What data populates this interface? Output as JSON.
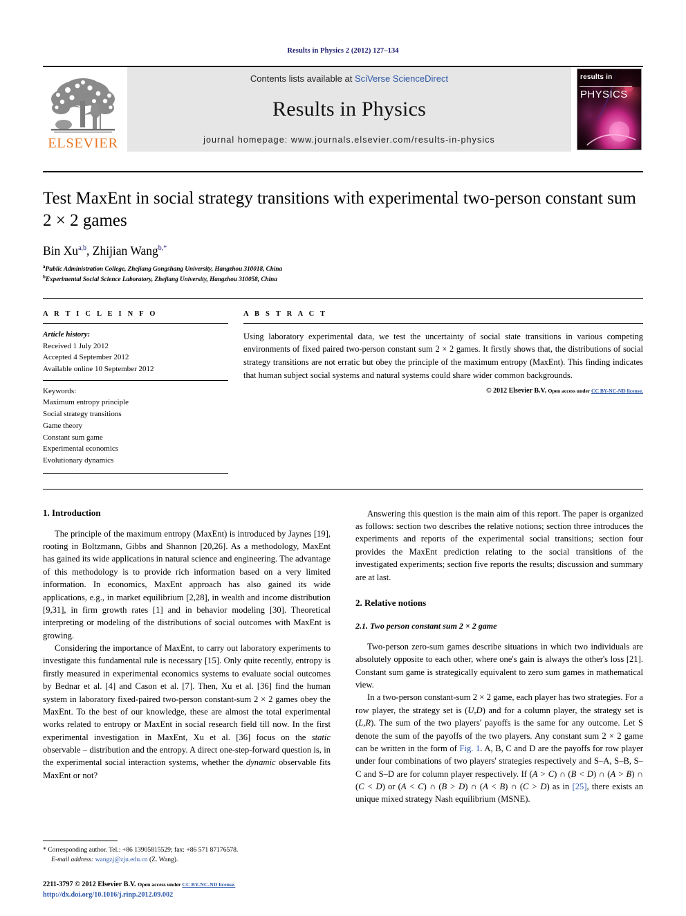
{
  "running_header": "Results in Physics 2 (2012) 127–134",
  "masthead": {
    "publisher_logo_text": "ELSEVIER",
    "contents_prefix": "Contents lists available at ",
    "contents_link": "SciVerse ScienceDirect",
    "journal_title": "Results in Physics",
    "homepage_label": "journal homepage: www.journals.elsevier.com/results-in-physics",
    "cover_top_label": "results in",
    "cover_main_label": "PHYSICS"
  },
  "article": {
    "title": "Test MaxEnt in social strategy transitions with experimental two-person constant sum 2 × 2 games",
    "authors_plain": "Bin Xu",
    "author1_sup": "a,b",
    "authors_sep": ", ",
    "author2": "Zhijian Wang",
    "author2_sup": "b,*",
    "affiliations": [
      {
        "marker": "a",
        "text": "Public Administration College, Zhejiang Gongshang University, Hangzhou 310018, China"
      },
      {
        "marker": "b",
        "text": "Experimental Social Science Laboratory, Zhejiang University, Hangzhou 310058, China"
      }
    ]
  },
  "info": {
    "heading": "A R T I C L E   I N F O",
    "history_label": "Article history:",
    "history": [
      "Received 1 July 2012",
      "Accepted 4 September 2012",
      "Available online 10 September 2012"
    ],
    "keywords_label": "Keywords:",
    "keywords": [
      "Maximum entropy principle",
      "Social strategy transitions",
      "Game theory",
      "Constant sum game",
      "Experimental economics",
      "Evolutionary dynamics"
    ]
  },
  "abstract": {
    "heading": "A B S T R A C T",
    "text": "Using laboratory experimental data, we test the uncertainty of social state transitions in various competing environments of fixed paired two-person constant sum 2 × 2 games. It firstly shows that, the distributions of social strategy transitions are not erratic but obey the principle of the maximum entropy (MaxEnt). This finding indicates that human subject social systems and natural systems could share wider common backgrounds.",
    "copyright_main": "© 2012 Elsevier B.V. ",
    "copyright_open": "Open access under ",
    "copyright_license": "CC BY-NC-ND license."
  },
  "body": {
    "left": {
      "section1_heading": "1. Introduction",
      "p1": "The principle of the maximum entropy (MaxEnt) is introduced by Jaynes [19], rooting in Boltzmann, Gibbs and Shannon [20,26]. As a methodology, MaxEnt has gained its wide applications in natural science and engineering. The advantage of this methodology is to provide rich information based on a very limited information. In economics, MaxEnt approach has also gained its wide applications, e.g., in market equilibrium [2,28], in wealth and income distribution [9,31], in firm growth rates [1] and in behavior modeling [30]. Theoretical interpreting or modeling of the distributions of social outcomes with MaxEnt is growing.",
      "p2_a": "Considering the importance of MaxEnt, to carry out laboratory experiments to investigate this fundamental rule is necessary [15]. Only quite recently, entropy is firstly measured in experimental economics systems to evaluate social outcomes by Bednar et al. [4] and Cason et al. [7]. Then, Xu et al. [36] find the human system in laboratory fixed-paired two-person constant-sum 2 × 2 games obey the MaxEnt. To the best of our knowledge, these are almost the total experimental works related to entropy or MaxEnt in social research field till now. In the first experimental investigation in MaxEnt, Xu et al. [36] focus on the ",
      "p2_it1": "static",
      "p2_b": " observable – distribution and the entropy. A direct one-step-forward question is, in the experimental social interaction systems, whether the ",
      "p2_it2": "dynamic",
      "p2_c": " observable fits MaxEnt or not?"
    },
    "right": {
      "p3": "Answering this question is the main aim of this report. The paper is organized as follows: section two describes the relative notions; section three introduces the experiments and reports of the experimental social transitions; section four provides the MaxEnt prediction relating to the social transitions of the investigated experiments; section five reports the results; discussion and summary are at last.",
      "section2_heading": "2. Relative notions",
      "subsection21_heading": "2.1. Two person constant sum 2 × 2 game",
      "p4": "Two-person zero-sum games describe situations in which two individuals are absolutely opposite to each other, where one's gain is always the other's loss [21]. Constant sum game is strategically equivalent to zero sum games in mathematical view.",
      "p5_a": "In a two-person constant-sum 2 × 2 game, each player has two strategies. For a row player, the strategy set is (",
      "p5_it1": "U,D",
      "p5_b": ") and for a column player, the strategy set is (",
      "p5_it2": "L,R",
      "p5_c": "). The sum of the two players' payoffs is the same for any outcome. Let S denote the sum of the payoffs of the two players. Any constant sum 2 × 2 game can be written in the form of ",
      "p5_figlink": "Fig. 1",
      "p5_d": ". A, B, C and D are the payoffs for row player under four combinations of two players' strategies respectively and S–A, S–B, S–C and S–D are for column player respectively. If  (",
      "p5_it3": "A > C",
      "p5_e": ")  ∩ (",
      "p5_it4": "B < D",
      "p5_f": ") ∩ (",
      "p5_it5": "A > B",
      "p5_g": ") ∩ (",
      "p5_it6": "C < D",
      "p5_h": ")  or  (",
      "p5_it7": "A < C",
      "p5_i": ") ∩ (",
      "p5_it8": "B > D",
      "p5_j": ") ∩ (",
      "p5_it9": "A < B",
      "p5_k": ") ∩ (",
      "p5_it10": "C > D",
      "p5_l": ") as in ",
      "p5_ref25": "[25]",
      "p5_m": ", there exists an unique mixed strategy Nash equilibrium (MSNE)."
    }
  },
  "footnotes": {
    "corresponding_marker": "*",
    "corresponding_text": "Corresponding author. Tel.: +86 13905815529; fax: +86 571 87176578.",
    "email_label": "E-mail address:",
    "email_link": "wangzj@zju.edu.cn",
    "email_suffix": " (Z. Wang).",
    "issn_prefix": "2211-3797 © 2012 Elsevier B.V. ",
    "issn_open": "Open access under ",
    "issn_license": "CC BY-NC-ND license.",
    "doi": "http://dx.doi.org/10.1016/j.rinp.2012.09.002"
  }
}
